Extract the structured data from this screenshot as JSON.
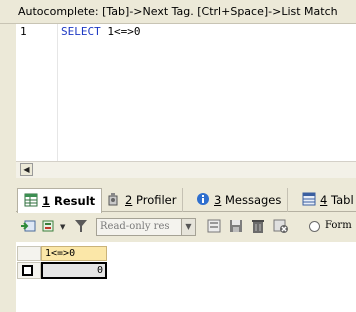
{
  "editor": {
    "hint_text": "Autocomplete: [Tab]->Next Tag. [Ctrl+Space]->List Match",
    "line_number": "1",
    "code_keyword": "SELECT",
    "code_rest": " 1<=>0"
  },
  "tabs": [
    {
      "num": "1",
      "label": "Result",
      "icon": "grid-icon",
      "active": true
    },
    {
      "num": "2",
      "label": "Profiler",
      "icon": "profiler-icon",
      "active": false
    },
    {
      "num": "3",
      "label": "Messages",
      "icon": "info-icon",
      "active": false
    },
    {
      "num": "4",
      "label": "Tabl",
      "icon": "table-icon",
      "active": false
    }
  ],
  "toolbar": {
    "readonly_select_value": "Read-only res",
    "form_label": "Form"
  },
  "grid": {
    "columns": [
      "1<=>0"
    ],
    "rows": [
      [
        "0"
      ]
    ]
  },
  "colors": {
    "background": "#ece9d8",
    "keyword": "#1d39c4",
    "column_header": "#fbe7a8"
  }
}
